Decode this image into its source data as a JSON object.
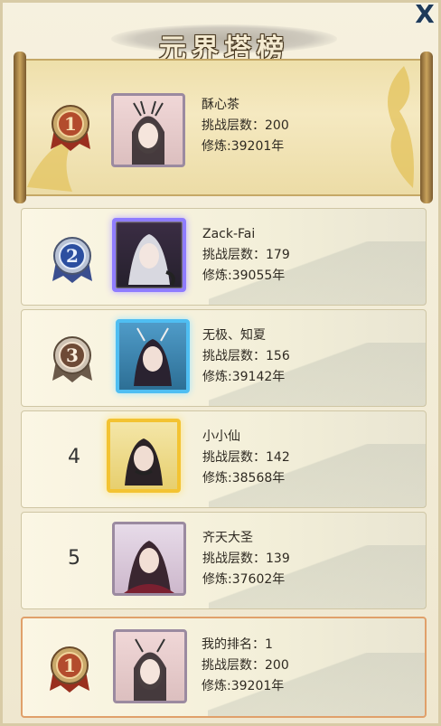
{
  "window": {
    "title": "元界塔榜",
    "close_glyph": "X"
  },
  "rankings": [
    {
      "rank": "1",
      "name": "酥心茶",
      "floors_label": "挑战层数：",
      "floors": "200",
      "cult_label": "修炼:",
      "cult": "39201年",
      "medal_color": "#b24a2c"
    },
    {
      "rank": "2",
      "name": "Zack-Fai",
      "floors_label": "挑战层数：",
      "floors": "179",
      "cult_label": "修炼:",
      "cult": "39055年",
      "medal_color": "#2a4fa0"
    },
    {
      "rank": "3",
      "name": "无极、知夏",
      "floors_label": "挑战层数：",
      "floors": "156",
      "cult_label": "修炼:",
      "cult": "39142年",
      "medal_color": "#6b4a3a"
    },
    {
      "rank": "4",
      "name": "小小仙",
      "floors_label": "挑战层数：",
      "floors": "142",
      "cult_label": "修炼:",
      "cult": "38568年"
    },
    {
      "rank": "5",
      "name": "齐天大圣",
      "floors_label": "挑战层数：",
      "floors": "139",
      "cult_label": "修炼:",
      "cult": "37602年"
    }
  ],
  "self": {
    "rank_label": "我的排名：",
    "rank": "1",
    "floors_label": "挑战层数：",
    "floors": "200",
    "cult_label": "修炼:",
    "cult": "39201年",
    "medal_rank": "1"
  }
}
